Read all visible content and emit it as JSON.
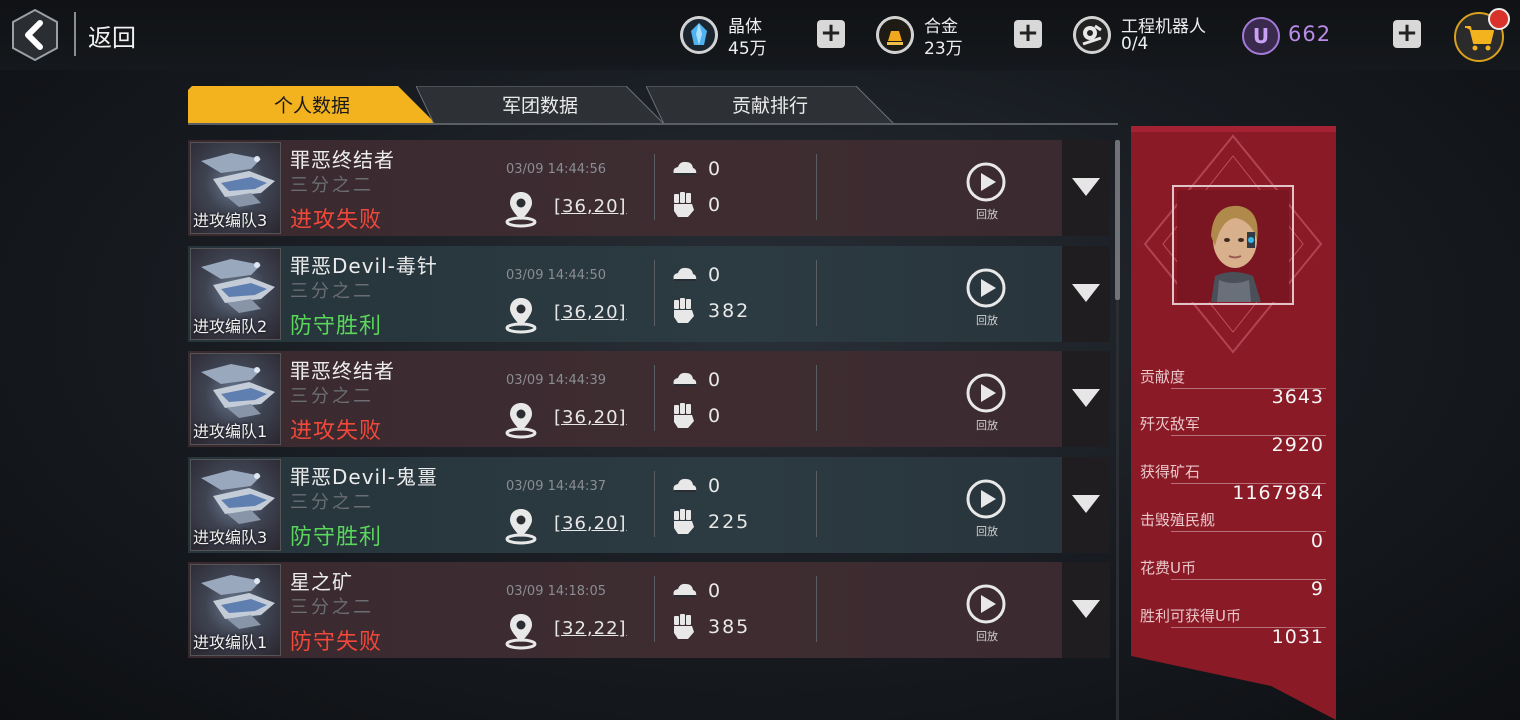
{
  "header": {
    "back_label": "返回",
    "resources": [
      {
        "name": "crystal-resource",
        "label": "晶体",
        "value": "45万",
        "icon": "crystal-icon"
      },
      {
        "name": "alloy-resource",
        "label": "合金",
        "value": "23万",
        "icon": "alloy-icon"
      },
      {
        "name": "robot-resource",
        "label": "工程机器人",
        "value": "0/4",
        "icon": "robot-icon"
      }
    ],
    "u_coin": {
      "symbol": "U",
      "value": "662"
    },
    "colors": {
      "accent_gold": "#f2b31e",
      "u_purple": "#b98be8",
      "panel_red": "#8a1a26"
    }
  },
  "tabs": [
    {
      "label": "个人数据",
      "active": true
    },
    {
      "label": "军团数据",
      "active": false
    },
    {
      "label": "贡献排行",
      "active": false
    }
  ],
  "records": [
    {
      "team": "进攻编队3",
      "name": "罪恶终结者",
      "sub": "三分之二",
      "result": "进攻失败",
      "status": "fail",
      "time": "03/09 14:44:56",
      "coord": "[36,20]",
      "top_value": "0",
      "bottom_value": "0",
      "replay": "回放"
    },
    {
      "team": "进攻编队2",
      "name": "罪恶Devil-毒针",
      "sub": "三分之二",
      "result": "防守胜利",
      "status": "win",
      "time": "03/09 14:44:50",
      "coord": "[36,20]",
      "top_value": "0",
      "bottom_value": "382",
      "replay": "回放"
    },
    {
      "team": "进攻编队1",
      "name": "罪恶终结者",
      "sub": "三分之二",
      "result": "进攻失败",
      "status": "fail",
      "time": "03/09 14:44:39",
      "coord": "[36,20]",
      "top_value": "0",
      "bottom_value": "0",
      "replay": "回放"
    },
    {
      "team": "进攻编队3",
      "name": "罪恶Devil-鬼畺",
      "sub": "三分之二",
      "result": "防守胜利",
      "status": "win",
      "time": "03/09 14:44:37",
      "coord": "[36,20]",
      "top_value": "0",
      "bottom_value": "225",
      "replay": "回放"
    },
    {
      "team": "进攻编队1",
      "name": "星之矿",
      "sub": "三分之二",
      "result": "防守失败",
      "status": "fail",
      "time": "03/09 14:18:05",
      "coord": "[32,22]",
      "top_value": "0",
      "bottom_value": "385",
      "replay": "回放"
    }
  ],
  "stats": [
    {
      "label": "贡献度",
      "value": "3643"
    },
    {
      "label": "歼灭敌军",
      "value": "2920"
    },
    {
      "label": "获得矿石",
      "value": "1167984"
    },
    {
      "label": "击毁殖民舰",
      "value": "0"
    },
    {
      "label": "花费U币",
      "value": "9"
    },
    {
      "label": "胜利可获得U币",
      "value": "1031"
    }
  ]
}
